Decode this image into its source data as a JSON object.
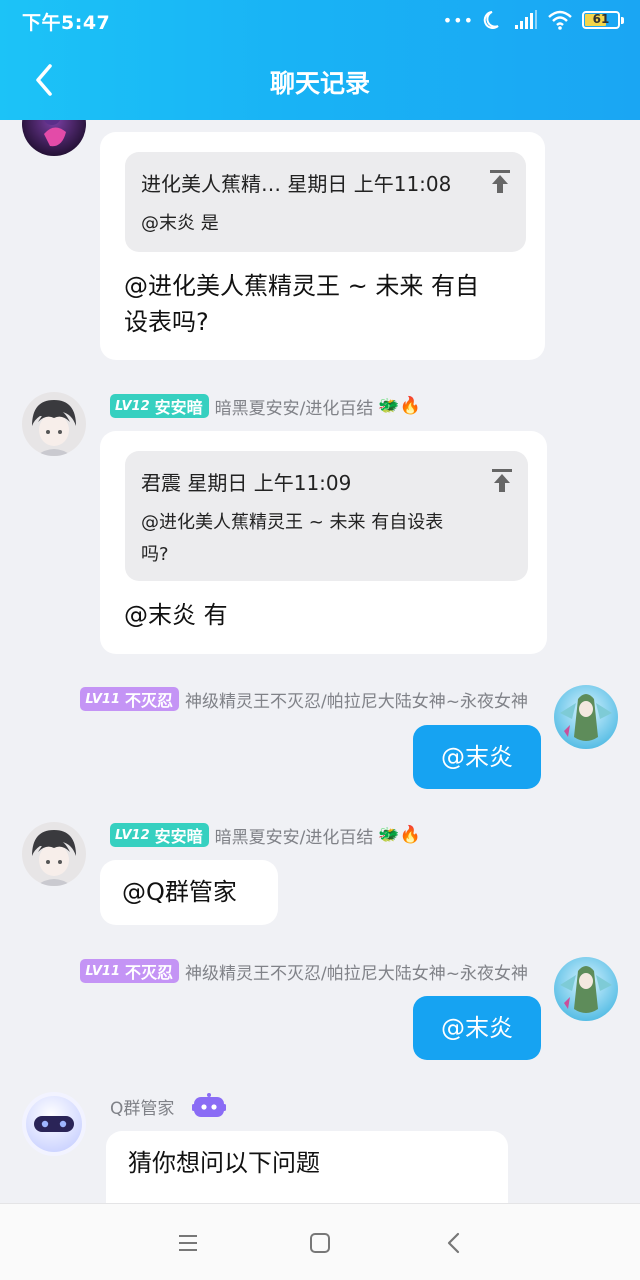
{
  "status_bar": {
    "time": "下午5:47",
    "battery": "61",
    "dots": "•••"
  },
  "header": {
    "title": "聊天记录"
  },
  "messages": [
    {
      "quote": {
        "head": "进化美人蕉精… 星期日 上午11:08",
        "body": "@末炎 是"
      },
      "text_lines": [
        "@进化美人蕉精灵王 ~ 未来 有自",
        "设表吗?"
      ]
    },
    {
      "badge_lv": "LV12",
      "badge_title": "安安暗",
      "name": "暗黑夏安安/进化百结",
      "emoji": "🐲🔥",
      "quote": {
        "head": "君震 星期日 上午11:09",
        "body_lines": [
          "@进化美人蕉精灵王 ~ 未来 有自设表",
          "吗?"
        ]
      },
      "text": "@末炎 有"
    },
    {
      "badge_lv": "LV11",
      "badge_title": "不灭忍",
      "name": "神级精灵王不灭忍/帕拉尼大陆女神~永夜女神",
      "text": "@末炎"
    },
    {
      "badge_lv": "LV12",
      "badge_title": "安安暗",
      "name": "暗黑夏安安/进化百结",
      "emoji": "🐲🔥",
      "text": "@Q群管家"
    },
    {
      "badge_lv": "LV11",
      "badge_title": "不灭忍",
      "name": "神级精灵王不灭忍/帕拉尼大陆女神~永夜女神",
      "text": "@末炎"
    },
    {
      "name": "Q群管家",
      "text": "猜你想问以下问题"
    }
  ],
  "colors": {
    "header_start": "#1cc3f7",
    "header_end": "#1aa6f3",
    "sent_bubble": "#16a3f2",
    "badge_teal": "#36d0c0",
    "badge_purple": "#c494f5",
    "bot_purple": "#8a6cf5"
  },
  "icons": [
    "back-arrow-icon",
    "moon-icon",
    "signal-icon",
    "wifi-icon",
    "battery-icon",
    "pin-top-icon",
    "robot-icon",
    "menu-icon",
    "home-icon",
    "back-icon"
  ]
}
